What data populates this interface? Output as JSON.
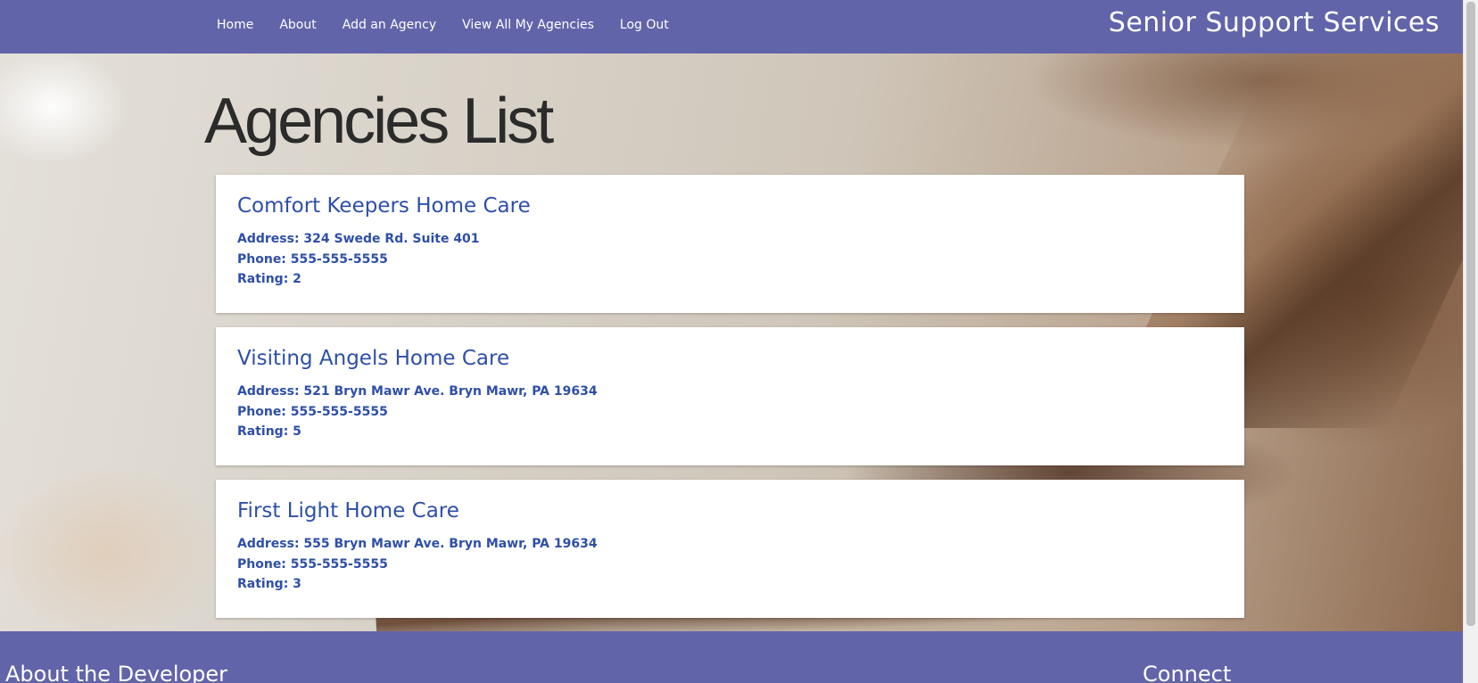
{
  "navbar": {
    "links": [
      "Home",
      "About",
      "Add an Agency",
      "View All My Agencies",
      "Log Out"
    ],
    "brand": "Senior Support Services"
  },
  "page": {
    "title": "Agencies List"
  },
  "agencies": [
    {
      "name": "Comfort Keepers Home Care",
      "address": "Address: 324 Swede Rd. Suite 401",
      "phone": "Phone: 555-555-5555",
      "rating": "Rating: 2"
    },
    {
      "name": "Visiting Angels Home Care",
      "address": "Address: 521 Bryn Mawr Ave. Bryn Mawr, PA 19634",
      "phone": "Phone: 555-555-5555",
      "rating": "Rating: 5"
    },
    {
      "name": "First Light Home Care",
      "address": "Address: 555 Bryn Mawr Ave. Bryn Mawr, PA 19634",
      "phone": "Phone: 555-555-5555",
      "rating": "Rating: 3"
    }
  ],
  "footer": {
    "about_heading": "About the Developer",
    "connect_heading": "Connect"
  },
  "colors": {
    "nav_background": "#6264aa",
    "agency_text": "#2e4fa8",
    "title_text": "#2b2b2b"
  }
}
